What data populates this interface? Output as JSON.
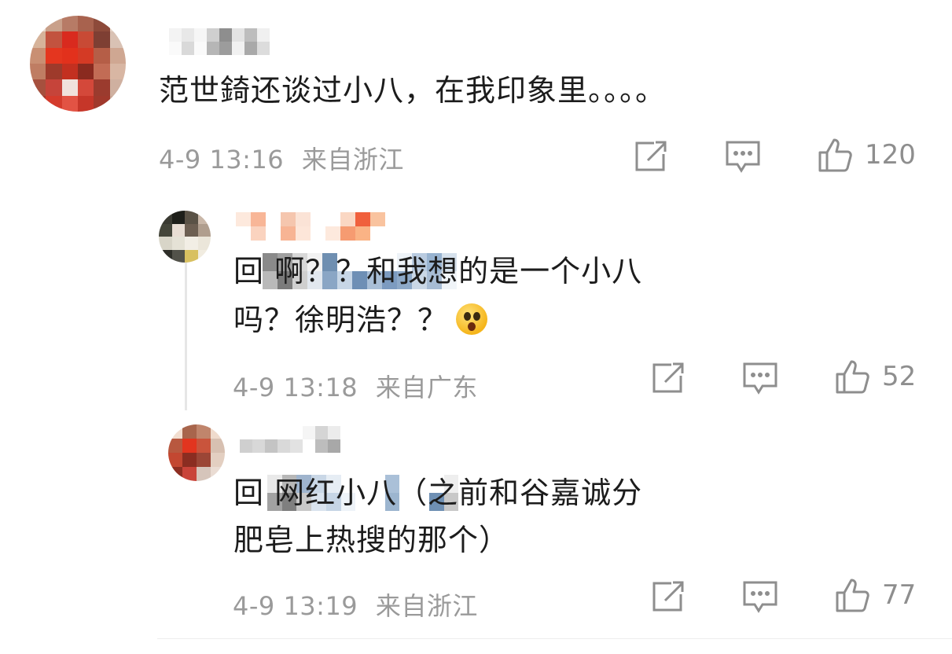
{
  "comments": [
    {
      "id": "c1",
      "text": "范世錡还谈过小八，在我印象里。。。。",
      "time": "4-9 13:16",
      "location": "来自浙江",
      "likes": "120"
    },
    {
      "id": "r1",
      "text_line1": "回                    啊？？和我想的是一个小八",
      "text_line2": "吗？徐明浩？？",
      "emoji": "astonished-face",
      "time": "4-9 13:18",
      "location": "来自广东",
      "likes": "52"
    },
    {
      "id": "r2",
      "text_line1": "回                    网红小八（之前和谷嘉诚分",
      "text_line2": "肥皂上热搜的那个）",
      "time": "4-9 13:19",
      "location": "来自浙江",
      "likes": "77"
    }
  ],
  "icons": {
    "repost": "repost-icon",
    "comment": "comment-icon",
    "like": "thumbs-up-icon"
  },
  "colors": {
    "text": "#1c1c1c",
    "meta": "#9a9a9a",
    "icon": "#8e8e8e"
  }
}
